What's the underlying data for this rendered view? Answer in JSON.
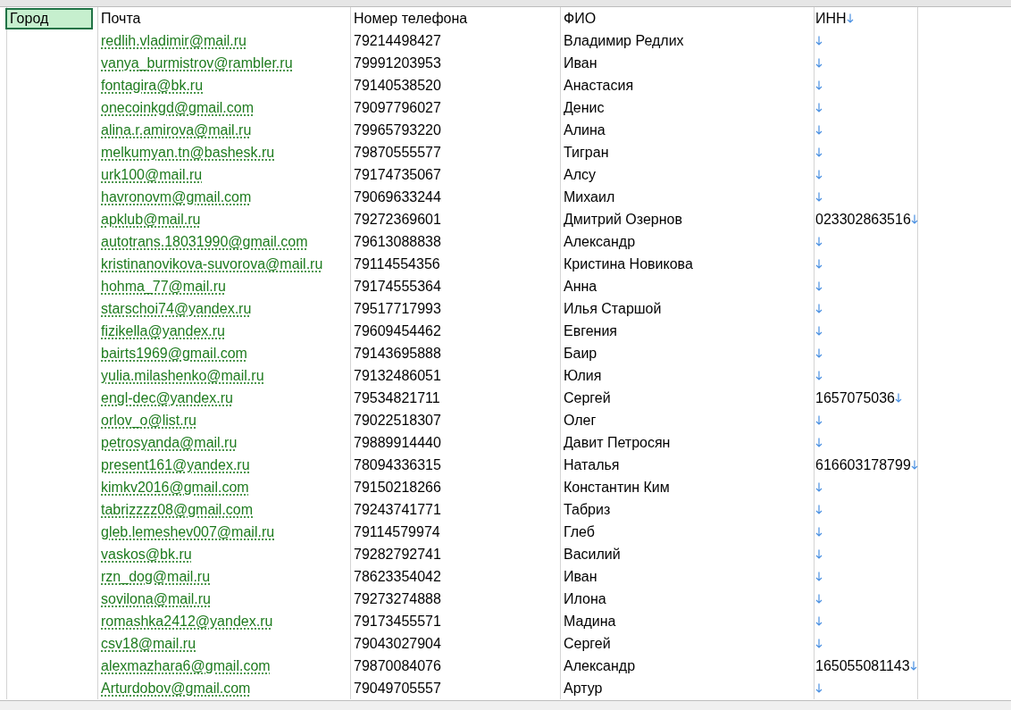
{
  "header": {
    "city": "Город",
    "email": "Почта",
    "phone": "Номер телефона",
    "name": "ФИО",
    "inn": "ИНН",
    "city_selected": true
  },
  "rows": [
    {
      "email": "redlih.vladimir@mail.ru",
      "phone": "79214498427",
      "name": "Владимир Редлих"
    },
    {
      "email": "vanya_burmistrov@rambler.ru",
      "phone": "79991203953",
      "name": "Иван"
    },
    {
      "email": "fontagira@bk.ru",
      "phone": "79140538520",
      "name": "Анастасия"
    },
    {
      "email": "onecoinkgd@gmail.com",
      "phone": "79097796027",
      "name": "Денис"
    },
    {
      "email": "alina.r.amirova@mail.ru",
      "phone": "79965793220",
      "name": "Алина"
    },
    {
      "email": "melkumyan.tn@bashesk.ru",
      "phone": "79870555577",
      "name": "Тигран"
    },
    {
      "email": "urk100@mail.ru",
      "phone": "79174735067",
      "name": "Алсу"
    },
    {
      "email": "havronovm@gmail.com",
      "phone": "79069633244",
      "name": "Михаил"
    },
    {
      "email": "apklub@mail.ru",
      "phone": "79272369601",
      "name": "Дмитрий Озернов",
      "inn": "023302863516"
    },
    {
      "email": "autotrans.18031990@gmail.com",
      "phone": "79613088838",
      "name": "Александр"
    },
    {
      "email": "kristinanovikova-suvorova@mail.ru",
      "phone": "79114554356",
      "name": "Кристина Новикова"
    },
    {
      "email": "hohma_77@mail.ru",
      "phone": "79174555364",
      "name": "Анна"
    },
    {
      "email": "starschoi74@yandex.ru",
      "phone": "79517717993",
      "name": "Илья Старшой"
    },
    {
      "email": "fizikella@yandex.ru",
      "phone": "79609454462",
      "name": "Евгения"
    },
    {
      "email": "bairts1969@gmail.com",
      "phone": "79143695888",
      "name": "Баир"
    },
    {
      "email": "yulia.milashenko@mail.ru",
      "phone": "79132486051",
      "name": "Юлия"
    },
    {
      "email": "engl-dec@yandex.ru",
      "phone": "79534821711",
      "name": "Сергей",
      "inn": "1657075036"
    },
    {
      "email": "orlov_o@list.ru",
      "phone": "79022518307",
      "name": "Олег"
    },
    {
      "email": "petrosyanda@mail.ru",
      "phone": "79889914440",
      "name": "Давит Петросян"
    },
    {
      "email": "present161@yandex.ru",
      "phone": "78094336315",
      "name": "Наталья",
      "inn": "616603178799"
    },
    {
      "email": "kimkv2016@gmail.com",
      "phone": "79150218266",
      "name": "Константин Ким"
    },
    {
      "email": "tabrizzzz08@gmail.com",
      "phone": "79243741771",
      "name": "Табриз"
    },
    {
      "email": "gleb.lemeshev007@mail.ru",
      "phone": "79114579974",
      "name": "Глеб"
    },
    {
      "email": "vaskos@bk.ru",
      "phone": "79282792741",
      "name": "Василий"
    },
    {
      "email": "rzn_dog@mail.ru",
      "phone": "78623354042",
      "name": "Иван"
    },
    {
      "email": "sovilona@mail.ru",
      "phone": "79273274888",
      "name": "Илона"
    },
    {
      "email": "romashka2412@yandex.ru",
      "phone": "79173455571",
      "name": "Мадина"
    },
    {
      "email": "csv18@mail.ru",
      "phone": "79043027904",
      "name": "Сергей"
    },
    {
      "email": "alexmazhara6@gmail.com",
      "phone": "79870084076",
      "name": "Александр",
      "inn": "165055081143"
    },
    {
      "email": "Arturdobov@gmail.com",
      "phone": "79049705557",
      "name": "Артур"
    }
  ]
}
